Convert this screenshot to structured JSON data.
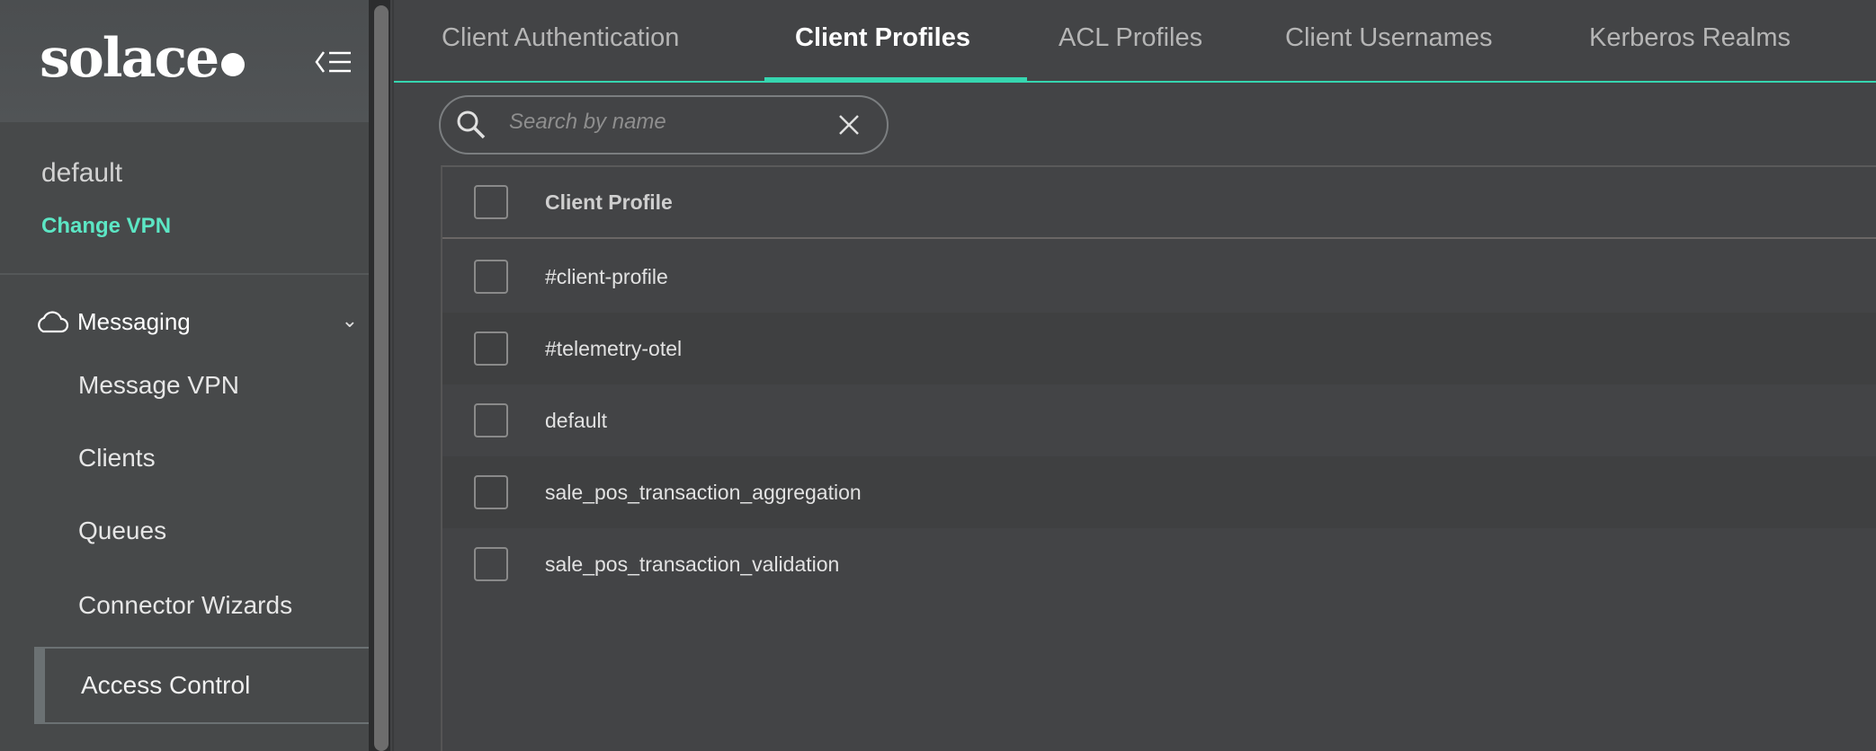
{
  "sidebar": {
    "logo": "solace",
    "vpn_name": "default",
    "change_vpn": "Change VPN",
    "section": "Messaging",
    "items": [
      "Message VPN",
      "Clients",
      "Queues",
      "Connector Wizards"
    ],
    "active_item": "Access Control"
  },
  "tabs": [
    {
      "label": "Client Authentication"
    },
    {
      "label": "Client Profiles",
      "active": true
    },
    {
      "label": "ACL Profiles"
    },
    {
      "label": "Client Usernames"
    },
    {
      "label": "Kerberos Realms"
    }
  ],
  "search": {
    "placeholder": "Search by name",
    "value": ""
  },
  "table": {
    "header": "Client Profile",
    "rows": [
      "#client-profile",
      "#telemetry-otel",
      "default",
      "sale_pos_transaction_aggregation",
      "sale_pos_transaction_validation"
    ]
  },
  "colors": {
    "accent": "#36d6b0",
    "link": "#5ce6c4"
  }
}
